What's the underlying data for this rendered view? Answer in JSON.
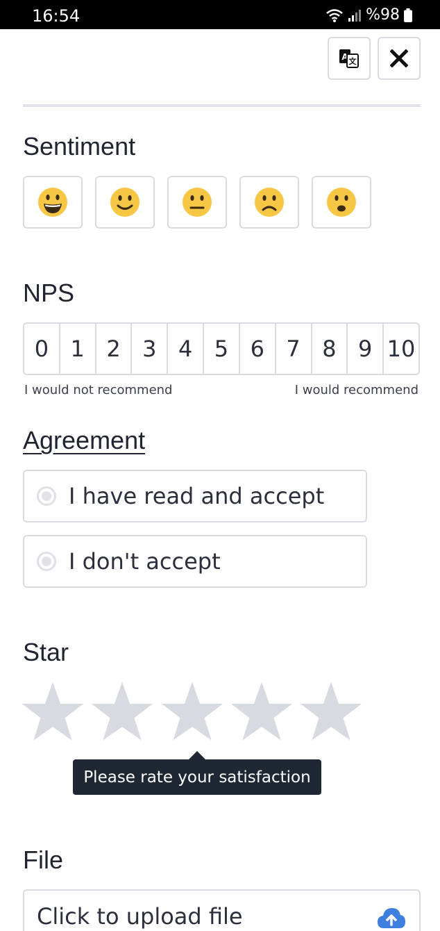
{
  "status": {
    "time": "16:54",
    "battery": "%98"
  },
  "toolbar": {
    "translate_icon": "translate-icon",
    "close_icon": "close-icon"
  },
  "sentiment": {
    "title": "Sentiment",
    "options": [
      "grinning-face-icon",
      "smiling-face-icon",
      "neutral-face-icon",
      "frowning-face-icon",
      "worried-face-icon"
    ]
  },
  "nps": {
    "title": "NPS",
    "scale": [
      "0",
      "1",
      "2",
      "3",
      "4",
      "5",
      "6",
      "7",
      "8",
      "9",
      "10"
    ],
    "low_label": "I would not recommend",
    "high_label": "I would recommend"
  },
  "agreement": {
    "title": "Agreement",
    "options": [
      "I have read and accept",
      "I don't accept"
    ]
  },
  "star": {
    "title": "Star",
    "count": 5,
    "color": "#d8dae2",
    "tooltip": "Please rate your satisfaction"
  },
  "file": {
    "title": "File",
    "upload_label": "Click to upload file",
    "icon": "cloud-upload-icon",
    "icon_color": "#3f7fe0"
  }
}
